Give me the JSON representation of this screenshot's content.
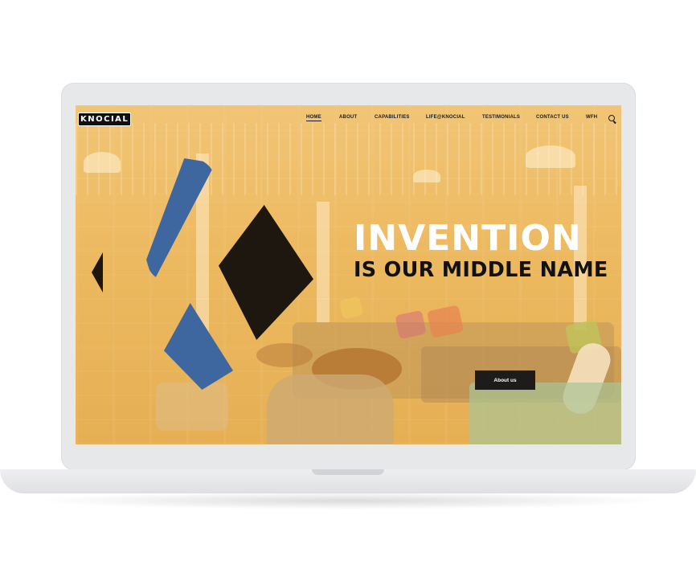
{
  "brand": {
    "logo_text": "KNOCIAL"
  },
  "nav": {
    "items": [
      {
        "label": "HOME",
        "active": true
      },
      {
        "label": "ABOUT"
      },
      {
        "label": "CAPABILITIES"
      },
      {
        "label": "LIFE@KNOCIAL"
      },
      {
        "label": "TESTIMONIALS"
      },
      {
        "label": "CONTACT US"
      },
      {
        "label": "WFH"
      }
    ],
    "search_icon": "search-icon"
  },
  "hero": {
    "title": "INVENTION",
    "subtitle": "IS OUR MIDDLE NAME",
    "cta_label": "About us"
  },
  "colors": {
    "overlay": "#f0b650",
    "logo_blue": "#3e67a0",
    "logo_dark": "#1e1710",
    "button_bg": "#1d1c1a",
    "laptop_frame": "#e7e8ea"
  }
}
